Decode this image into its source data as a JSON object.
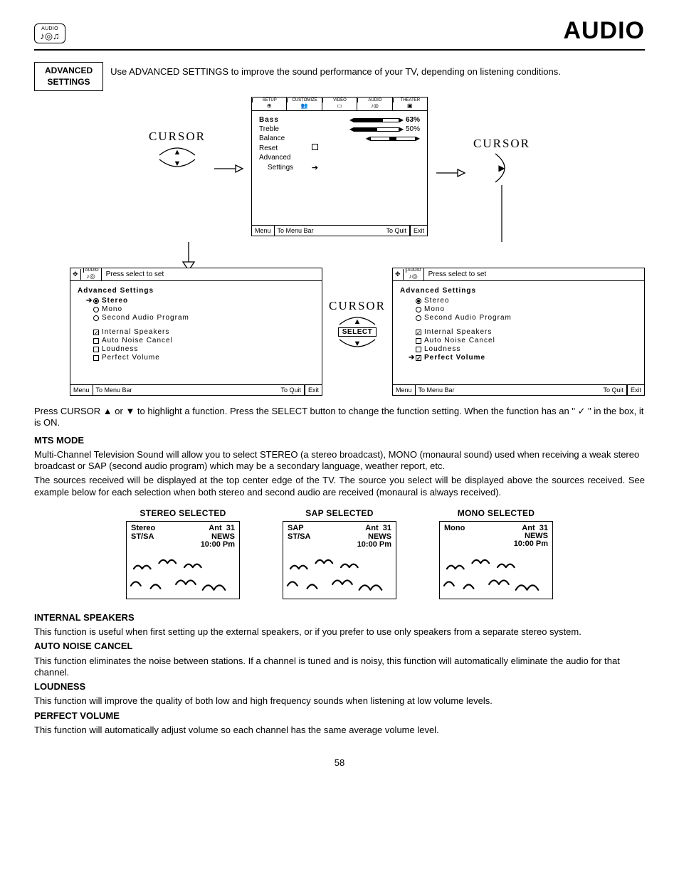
{
  "header": {
    "icon_label": "AUDIO",
    "title": "AUDIO"
  },
  "advanced_settings": {
    "box_label_line1": "ADVANCED",
    "box_label_line2": "SETTINGS",
    "intro": "Use ADVANCED SETTINGS to improve the sound performance of your TV, depending on listening conditions."
  },
  "cursor_label": "CURSOR",
  "select_label": "SELECT",
  "main_menu": {
    "tabs": [
      "SETUP",
      "CUSTOMIZE",
      "VIDEO",
      "AUDIO",
      "THEATER"
    ],
    "items": {
      "bass": {
        "label": "Bass",
        "value": "63%",
        "fill": 63
      },
      "treble": {
        "label": "Treble",
        "value": "50%",
        "fill": 50
      },
      "balance": {
        "label": "Balance"
      },
      "reset": {
        "label": "Reset"
      },
      "adv1": "Advanced",
      "adv2": "Settings"
    },
    "footer": {
      "a": "Menu",
      "b": "To Menu Bar",
      "c": "To Quit",
      "d": "Exit"
    }
  },
  "adv_left": {
    "press_select": "Press select to set",
    "title": "Advanced Settings",
    "opts": [
      {
        "ptr": true,
        "kind": "radio",
        "sel": true,
        "label": "Stereo",
        "bold": true
      },
      {
        "kind": "radio",
        "sel": false,
        "label": "Mono"
      },
      {
        "kind": "radio",
        "sel": false,
        "label": "Second Audio Program"
      }
    ],
    "opts2": [
      {
        "kind": "chk",
        "mark": "✓",
        "label": "Internal Speakers"
      },
      {
        "kind": "chk",
        "mark": "",
        "label": "Auto Noise Cancel"
      },
      {
        "kind": "chk",
        "mark": "",
        "label": "Loudness"
      },
      {
        "kind": "chk",
        "mark": "",
        "label": "Perfect Volume"
      }
    ],
    "footer": {
      "a": "Menu",
      "b": "To Menu Bar",
      "c": "To Quit",
      "d": "Exit"
    }
  },
  "adv_right": {
    "press_select": "Press select to set",
    "title": "Advanced Settings",
    "opts": [
      {
        "kind": "radio",
        "sel": true,
        "label": "Stereo"
      },
      {
        "kind": "radio",
        "sel": false,
        "label": "Mono"
      },
      {
        "kind": "radio",
        "sel": false,
        "label": "Second Audio Program"
      }
    ],
    "opts2": [
      {
        "kind": "chk",
        "mark": "✓",
        "label": "Internal Speakers"
      },
      {
        "kind": "chk",
        "mark": "",
        "label": "Auto Noise Cancel"
      },
      {
        "kind": "chk",
        "mark": "",
        "label": "Loudness"
      },
      {
        "ptr": true,
        "kind": "chk",
        "mark": "✓",
        "label": "Perfect Volume",
        "bold": true
      }
    ],
    "footer": {
      "a": "Menu",
      "b": "To Menu Bar",
      "c": "To Quit",
      "d": "Exit"
    }
  },
  "paragraph1_a": "Press CURSOR ▲ or ▼ to highlight a function. Press the SELECT button to change the function setting. When the function has an \" ✓ \" in the box, it is ON.",
  "mts": {
    "heading": "MTS MODE",
    "p1": "Multi-Channel Television Sound will allow you to select STEREO (a stereo broadcast), MONO (monaural sound) used when receiving a weak stereo broadcast or SAP (second audio program) which may be a secondary language, weather report, etc.",
    "p2": "The sources received will be displayed at the top center edge of the TV.  The source you select will be displayed above the sources received.  See example below for each selection when both stereo and second audio are received (monaural is always received)."
  },
  "examples": {
    "stereo": {
      "title": "STEREO SELECTED",
      "mode": "Stereo",
      "ant": "Ant",
      "ch": "31",
      "stsa": "ST/SA",
      "news": "NEWS",
      "time": "10:00 Pm"
    },
    "sap": {
      "title": "SAP SELECTED",
      "mode": "SAP",
      "ant": "Ant",
      "ch": "31",
      "stsa": "ST/SA",
      "news": "NEWS",
      "time": "10:00 Pm"
    },
    "mono": {
      "title": "MONO SELECTED",
      "mode": "Mono",
      "ant": "Ant",
      "ch": "31",
      "stsa": "",
      "news": "NEWS",
      "time": "10:00 Pm"
    }
  },
  "sections": {
    "int_spk_h": "INTERNAL SPEAKERS",
    "int_spk_p": "This function is useful when first setting up the external speakers, or if you prefer to use only speakers from a separate stereo system.",
    "anc_h": "AUTO NOISE CANCEL",
    "anc_p": "This function eliminates the noise between stations. If a channel is tuned and is noisy, this function will automatically eliminate the audio for that channel.",
    "loud_h": "LOUDNESS",
    "loud_p": "This function will improve the quality of both low and high frequency sounds when listening at low volume levels.",
    "pv_h": "PERFECT VOLUME",
    "pv_p": "This function will automatically adjust volume so each channel has the same average volume level."
  },
  "page_number": "58",
  "icon_label_short": "AUDIO"
}
